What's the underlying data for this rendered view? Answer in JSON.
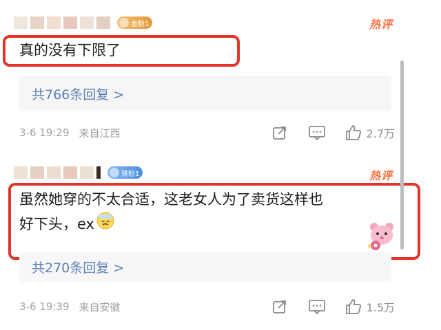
{
  "comments": [
    {
      "badge": "金粉1",
      "hot": "热评",
      "text": "真的没有下限了",
      "replies": "共766条回复 >",
      "time": "3-6 19:29",
      "location": "来自江西",
      "likes": "2.7万"
    },
    {
      "badge": "铁粉1",
      "hot": "热评",
      "text_line1": "虽然她穿的不太合适，这老女人为了卖货这样也",
      "text_line2": "好下头，ex",
      "replies": "共270条回复 >",
      "time": "3-6 19:39",
      "location": "来自安徽",
      "likes": "1.5万"
    }
  ],
  "icons": {
    "share": "share-icon",
    "comment": "comment-icon",
    "like": "thumbs-up-icon",
    "emoji": "sick-face-emoji",
    "sticker": "pink-bear-sticker"
  },
  "colors": {
    "highlight_border": "#e3342b",
    "hot_tag": "#ff6c3a",
    "reply_link": "#5b80b5",
    "meta_text": "#a0a0a0"
  }
}
